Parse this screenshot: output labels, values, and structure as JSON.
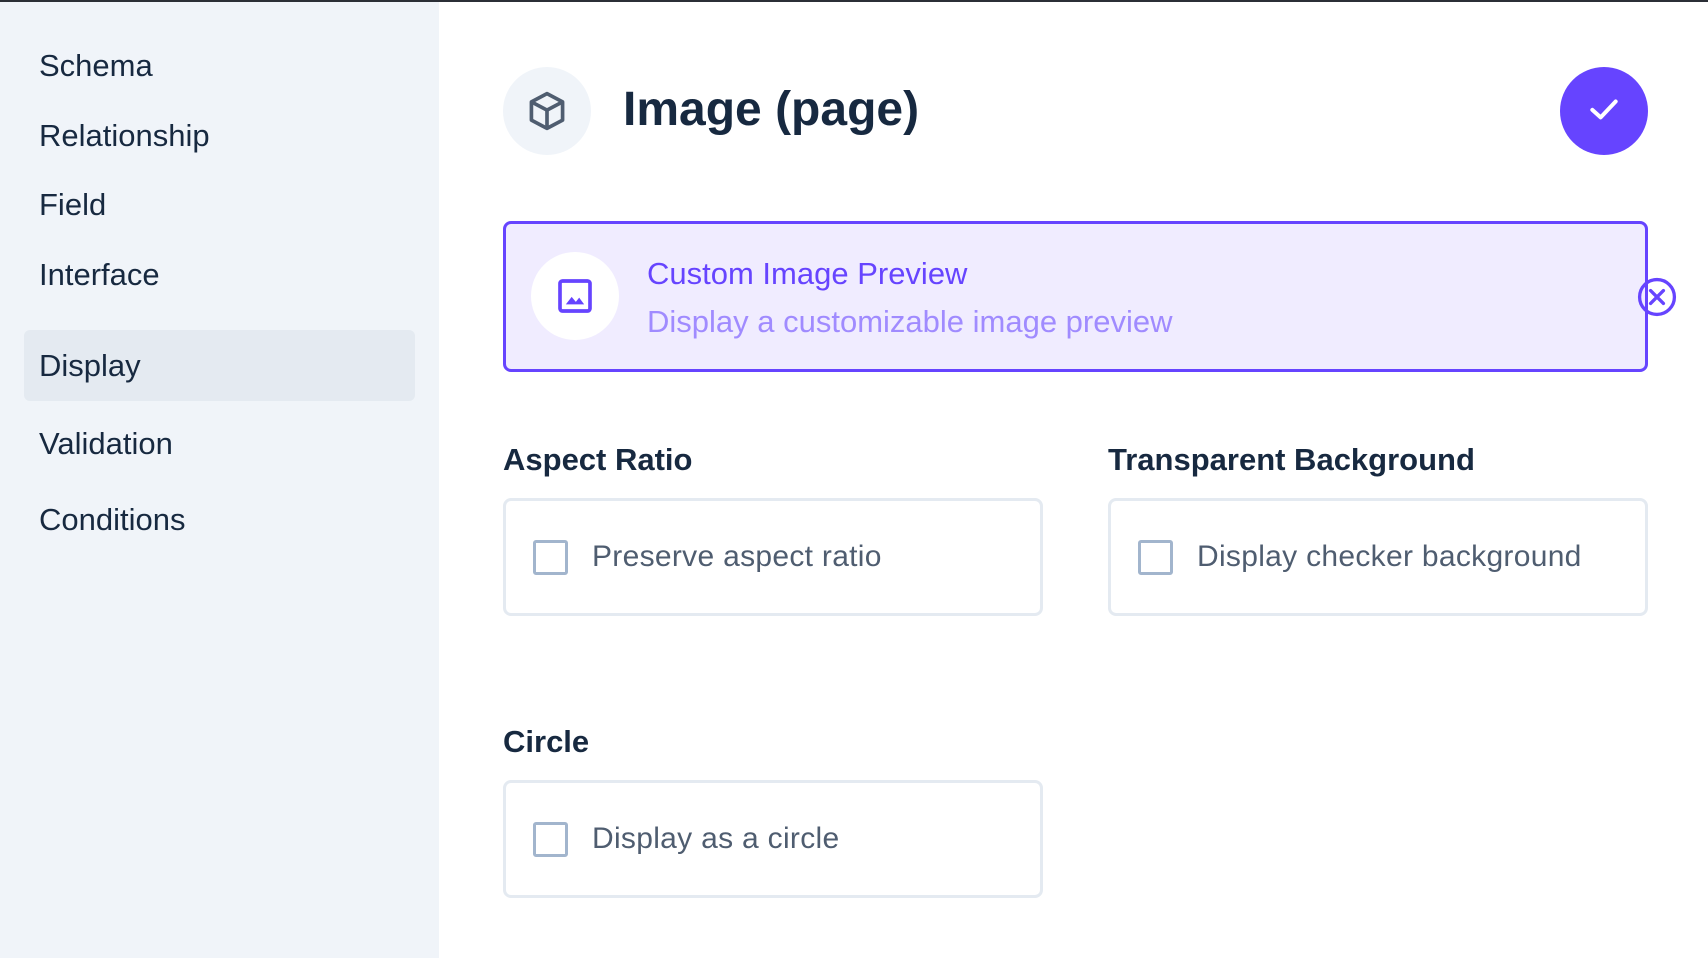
{
  "sidebar": {
    "items": [
      {
        "label": "Schema"
      },
      {
        "label": "Relationship"
      },
      {
        "label": "Field"
      },
      {
        "label": "Interface"
      },
      {
        "label": "Display",
        "active": true
      },
      {
        "label": "Validation"
      },
      {
        "label": "Conditions"
      }
    ]
  },
  "header": {
    "title": "Image (page)",
    "icon": "cube-icon",
    "save_icon": "check-icon"
  },
  "selected_display": {
    "title": "Custom Image Preview",
    "description": "Display a customizable image preview",
    "icon": "image-icon",
    "close_icon": "close-circle-icon"
  },
  "options": {
    "aspect_ratio": {
      "label": "Aspect Ratio",
      "checkbox_label": "Preserve aspect ratio",
      "checked": false
    },
    "transparent_background": {
      "label": "Transparent Background",
      "checkbox_label": "Display checker background",
      "checked": false
    },
    "circle": {
      "label": "Circle",
      "checkbox_label": "Display as a circle",
      "checked": false
    }
  },
  "colors": {
    "accent": "#6644ff",
    "sidebar_bg": "#f0f4f9",
    "text": "#172940"
  }
}
